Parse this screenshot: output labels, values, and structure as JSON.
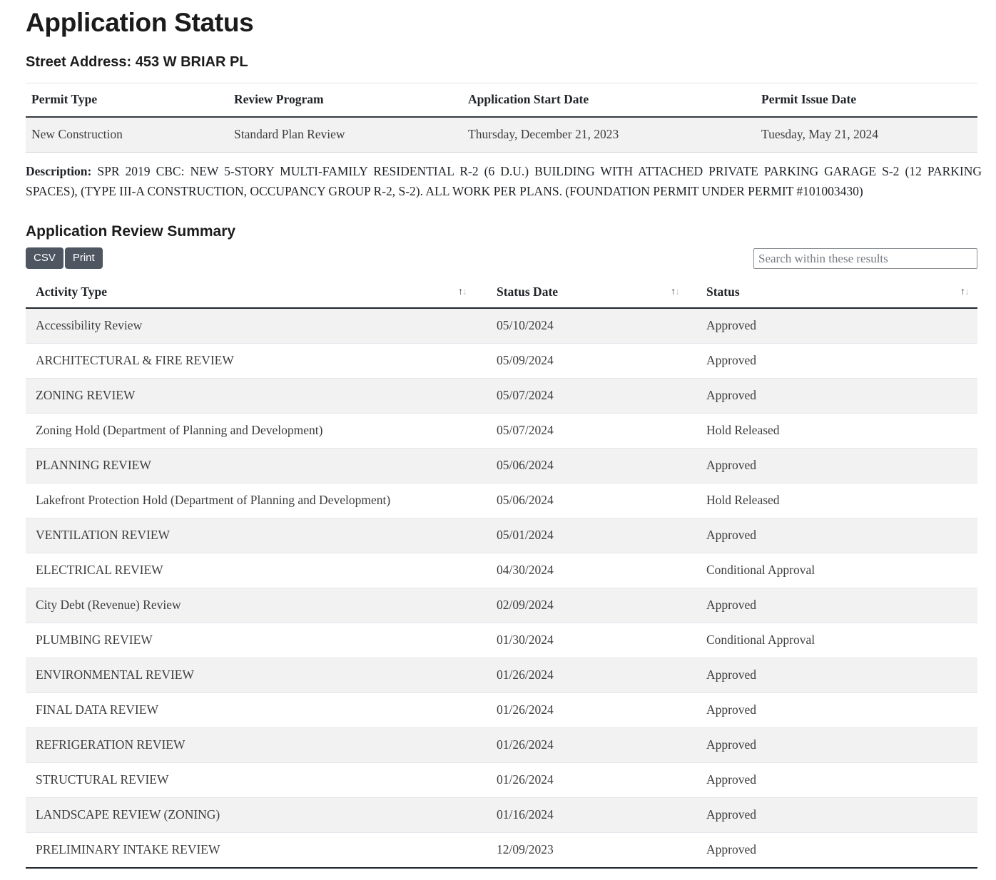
{
  "page_title": "Application Status",
  "street_address_line": "Street Address: 453 W BRIAR PL",
  "permit_summary": {
    "headers": [
      "Permit Type",
      "Review Program",
      "Application Start Date",
      "Permit Issue Date"
    ],
    "row": {
      "permit_type": "New Construction",
      "review_program": "Standard Plan Review",
      "application_start_date": "Thursday, December 21, 2023",
      "permit_issue_date": "Tuesday, May 21, 2024"
    }
  },
  "description": {
    "label": "Description:",
    "text": "SPR 2019 CBC: NEW 5-STORY MULTI-FAMILY RESIDENTIAL R-2 (6 D.U.) BUILDING WITH ATTACHED PRIVATE PARKING GARAGE S-2 (12 PARKING SPACES), (TYPE III-A CONSTRUCTION, OCCUPANCY GROUP R-2, S-2). ALL WORK PER PLANS. (FOUNDATION PERMIT UNDER PERMIT #101003430)"
  },
  "review_summary": {
    "section_title": "Application Review Summary",
    "toolbar": {
      "csv_label": "CSV",
      "print_label": "Print",
      "search_placeholder": "Search within these results",
      "search_value": ""
    },
    "headers": [
      "Activity Type",
      "Status Date",
      "Status"
    ],
    "sort_icon": {
      "up": "↑",
      "down": "↓"
    },
    "rows": [
      {
        "activity": "Accessibility Review",
        "date": "05/10/2024",
        "status": "Approved"
      },
      {
        "activity": "ARCHITECTURAL & FIRE REVIEW",
        "date": "05/09/2024",
        "status": "Approved"
      },
      {
        "activity": "ZONING REVIEW",
        "date": "05/07/2024",
        "status": "Approved"
      },
      {
        "activity": "Zoning Hold (Department of Planning and Development)",
        "date": "05/07/2024",
        "status": "Hold Released"
      },
      {
        "activity": "PLANNING REVIEW",
        "date": "05/06/2024",
        "status": "Approved"
      },
      {
        "activity": "Lakefront Protection Hold (Department of Planning and Development)",
        "date": "05/06/2024",
        "status": "Hold Released"
      },
      {
        "activity": "VENTILATION REVIEW",
        "date": "05/01/2024",
        "status": "Approved"
      },
      {
        "activity": "ELECTRICAL REVIEW",
        "date": "04/30/2024",
        "status": "Conditional Approval"
      },
      {
        "activity": "City Debt (Revenue) Review",
        "date": "02/09/2024",
        "status": "Approved"
      },
      {
        "activity": "PLUMBING REVIEW",
        "date": "01/30/2024",
        "status": "Conditional Approval"
      },
      {
        "activity": "ENVIRONMENTAL REVIEW",
        "date": "01/26/2024",
        "status": "Approved"
      },
      {
        "activity": "FINAL DATA REVIEW",
        "date": "01/26/2024",
        "status": "Approved"
      },
      {
        "activity": "REFRIGERATION REVIEW",
        "date": "01/26/2024",
        "status": "Approved"
      },
      {
        "activity": "STRUCTURAL REVIEW",
        "date": "01/26/2024",
        "status": "Approved"
      },
      {
        "activity": "LANDSCAPE REVIEW (ZONING)",
        "date": "01/16/2024",
        "status": "Approved"
      },
      {
        "activity": "PRELIMINARY INTAKE REVIEW",
        "date": "12/09/2023",
        "status": "Approved"
      }
    ]
  },
  "colors": {
    "button_bg": "#4e5662",
    "row_stripe": "#f2f2f2",
    "header_rule": "#212529"
  }
}
